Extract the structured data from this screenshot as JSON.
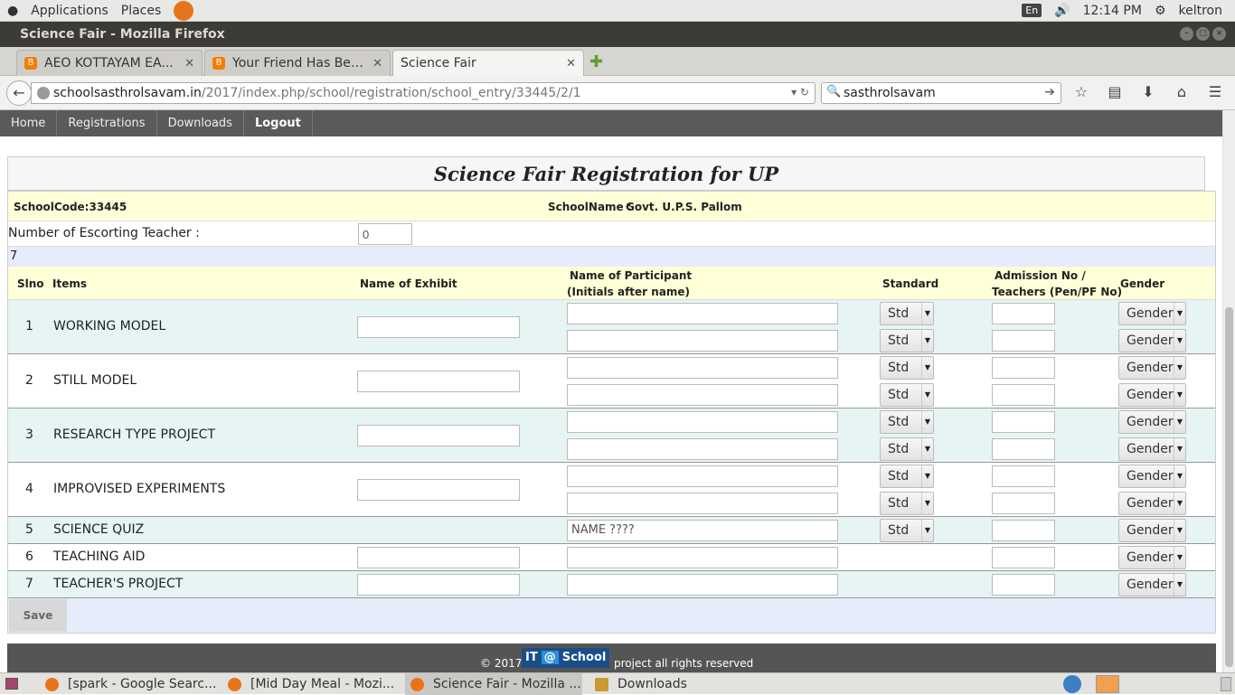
{
  "topbar": {
    "applications": "Applications",
    "places": "Places",
    "lang": "En",
    "time": "12:14 PM",
    "user": "keltron"
  },
  "window_title": "Science Fair - Mozilla Firefox",
  "tabs": [
    {
      "label": "AEO KOTTAYAM EA..."
    },
    {
      "label": "Your Friend Has Bee..."
    },
    {
      "label": "Science Fair"
    }
  ],
  "url": {
    "host": "schoolsasthrolsavam.in",
    "path": "/2017/index.php/school/registration/school_entry/33445/2/1"
  },
  "search": {
    "value": "sasthrolsavam"
  },
  "sitenav": [
    "Home",
    "Registrations",
    "Downloads",
    "Logout"
  ],
  "page": {
    "title": "Science Fair Registration for UP",
    "school_code": "SchoolCode:33445",
    "school_name_label": "SchoolName :",
    "school_name": "Govt. U.P.S. Pallom",
    "escort_label": "Number of Escorting Teacher :",
    "escort_value": "0",
    "count": "7",
    "columns": {
      "slno": "Slno",
      "items": "Items",
      "exhibit": "Name of Exhibit",
      "participant_1": "Name of Participant",
      "participant_2": "(Initials after name)",
      "standard": "Standard",
      "admission_1": "Admission No /",
      "admission_2": "Teachers (Pen/PF No)",
      "gender": "Gender"
    },
    "std_label": "Std",
    "gender_label": "Gender",
    "items": [
      {
        "no": "1",
        "name": "WORKING MODEL"
      },
      {
        "no": "2",
        "name": "STILL MODEL"
      },
      {
        "no": "3",
        "name": "RESEARCH TYPE PROJECT"
      },
      {
        "no": "4",
        "name": "IMPROVISED EXPERIMENTS"
      },
      {
        "no": "5",
        "name": "SCIENCE QUIZ",
        "participant_value": "NAME ????"
      },
      {
        "no": "6",
        "name": "TEACHING AID"
      },
      {
        "no": "7",
        "name": "TEACHER'S PROJECT"
      }
    ],
    "save": "Save"
  },
  "footer": {
    "copyright": "© 2017",
    "logo_it": "IT",
    "logo_at": "@",
    "logo_school": "School",
    "rights": "project all rights reserved"
  },
  "taskbar": [
    {
      "label": "[spark - Google Searc..."
    },
    {
      "label": "[Mid Day Meal - Mozi..."
    },
    {
      "label": "Science Fair - Mozilla ..."
    },
    {
      "label": "Downloads"
    }
  ]
}
